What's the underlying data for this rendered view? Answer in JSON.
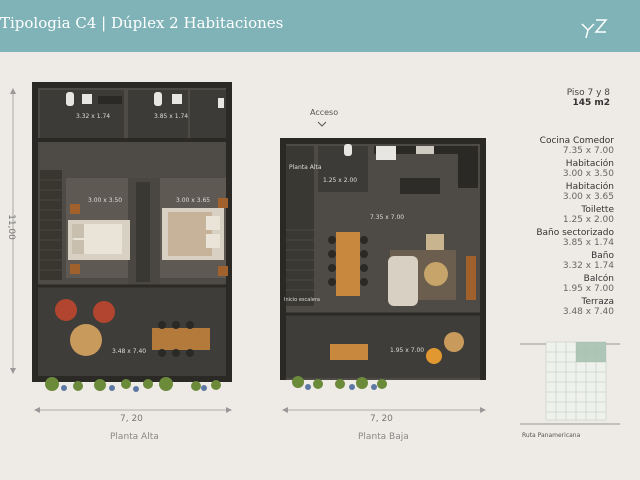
{
  "header": {
    "title": "Tipologia C4 | Dúplex 2 Habitaciones",
    "logo": "yz-logo"
  },
  "plans": {
    "upper": {
      "caption": "Planta Alta",
      "width": "7, 20",
      "height": "11,00",
      "labels": [
        "3.32 x 1.74",
        "3.85 x 1.74",
        "3.00 x 3.50",
        "3.00 x 3.65",
        "3.48 x 7.40"
      ]
    },
    "lower": {
      "caption": "Planta Baja",
      "width": "7, 20",
      "access": "Acceso",
      "labels": [
        "Planta Alta",
        "1.25 x 2.00",
        "7.35 x 7.00",
        "Inicio escalera",
        "1.95 x 7.00"
      ]
    }
  },
  "info": {
    "floors": "Piso 7 y 8",
    "area": "145 m2",
    "rooms": [
      {
        "name": "Cocina Comedor",
        "dims": "7.35 x 7.00"
      },
      {
        "name": "Habitación",
        "dims": "3.00 x 3.50"
      },
      {
        "name": "Habitación",
        "dims": "3.00 x 3.65"
      },
      {
        "name": "Toilette",
        "dims": "1.25 x 2.00"
      },
      {
        "name": "Baño sectorizado",
        "dims": "3.85 x 1.74"
      },
      {
        "name": "Baño",
        "dims": "3.32 x 1.74"
      },
      {
        "name": "Balcón",
        "dims": "1.95 x 7.00"
      },
      {
        "name": "Terraza",
        "dims": "3.48 x 7.40"
      }
    ],
    "road": "Ruta Panamericana"
  },
  "colors": {
    "header": "#7fb3b7",
    "background": "#eeebe6",
    "walls": "#2b2926",
    "floor": "#5b5852",
    "highlight": "#9dbba9"
  }
}
